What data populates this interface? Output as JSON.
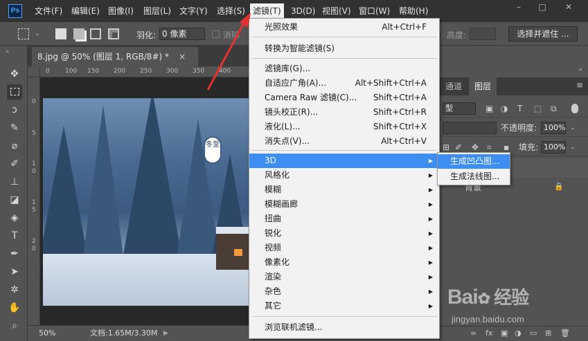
{
  "app": {
    "logo": "Ps"
  },
  "menubar": {
    "items": [
      {
        "label": "文件(F)"
      },
      {
        "label": "编辑(E)"
      },
      {
        "label": "图像(I)"
      },
      {
        "label": "图层(L)"
      },
      {
        "label": "文字(Y)"
      },
      {
        "label": "选择(S)"
      },
      {
        "label": "滤镜(T)"
      },
      {
        "label": "3D(D)"
      },
      {
        "label": "视图(V)"
      },
      {
        "label": "窗口(W)"
      },
      {
        "label": "帮助(H)"
      }
    ],
    "active_index": 6,
    "window_buttons": [
      "–",
      "□",
      "✕"
    ]
  },
  "options_bar": {
    "feather_label": "羽化:",
    "feather_value": "0 像素",
    "antialias_label": "消除",
    "height_label": "高度:",
    "select_mask_button": "选择并遮住 ..."
  },
  "document": {
    "tab_title": "8.jpg @ 50% (图层 1, RGB/8#) *",
    "close_glyph": "×",
    "zoom": "50%",
    "doc_info": "文档:1.65M/3.30M",
    "ruler_h_ticks": [
      "0",
      "100",
      "150",
      "200",
      "250",
      "300",
      "350",
      "400"
    ],
    "ruler_v_ticks": [
      "0",
      "5",
      "1",
      "0",
      "1",
      "5",
      "2",
      "0"
    ],
    "badge_text": "冬至"
  },
  "filter_menu": {
    "items": [
      {
        "label": "光照效果",
        "shortcut": "Alt+Ctrl+F"
      },
      {
        "label": "转换为智能滤镜(S)",
        "shortcut": ""
      },
      {
        "label": "滤镜库(G)...",
        "shortcut": ""
      },
      {
        "label": "自适应广角(A)...",
        "shortcut": "Alt+Shift+Ctrl+A"
      },
      {
        "label": "Camera Raw 滤镜(C)...",
        "shortcut": "Shift+Ctrl+A"
      },
      {
        "label": "镜头校正(R)...",
        "shortcut": "Shift+Ctrl+R"
      },
      {
        "label": "液化(L)...",
        "shortcut": "Shift+Ctrl+X"
      },
      {
        "label": "消失点(V)...",
        "shortcut": "Alt+Ctrl+V"
      },
      {
        "label": "3D",
        "shortcut": ""
      },
      {
        "label": "风格化",
        "shortcut": ""
      },
      {
        "label": "模糊",
        "shortcut": ""
      },
      {
        "label": "模糊画廊",
        "shortcut": ""
      },
      {
        "label": "扭曲",
        "shortcut": ""
      },
      {
        "label": "锐化",
        "shortcut": ""
      },
      {
        "label": "视频",
        "shortcut": ""
      },
      {
        "label": "像素化",
        "shortcut": ""
      },
      {
        "label": "渲染",
        "shortcut": ""
      },
      {
        "label": "杂色",
        "shortcut": ""
      },
      {
        "label": "其它",
        "shortcut": ""
      },
      {
        "label": "浏览联机滤镜...",
        "shortcut": ""
      }
    ],
    "highlighted_index": 8,
    "submenu_arrow": "▶"
  },
  "submenu_3d": {
    "items": [
      {
        "label": "生成凹凸图..."
      },
      {
        "label": "生成法线图..."
      }
    ],
    "highlighted_index": 0
  },
  "layers_panel": {
    "tabs": [
      "通道",
      "图层"
    ],
    "kind_label": "型",
    "opacity_label": "不透明度:",
    "opacity_value": "100%",
    "fill_label": "填充:",
    "fill_value": "100%",
    "lock_glyph": "🔒",
    "bg_layer_name": "背景",
    "bottom_icons": [
      "fx",
      "▣",
      "◑",
      "▭",
      "⊞",
      "🗑"
    ]
  },
  "watermark": {
    "logo_text": "Bai",
    "logo_suffix": "经验",
    "url": "jingyan.baidu.com"
  },
  "colors": {
    "menu_bg": "#323232",
    "panel_bg": "#535353",
    "highlight": "#3d8ef0",
    "annotation_arrow": "#e53030"
  }
}
